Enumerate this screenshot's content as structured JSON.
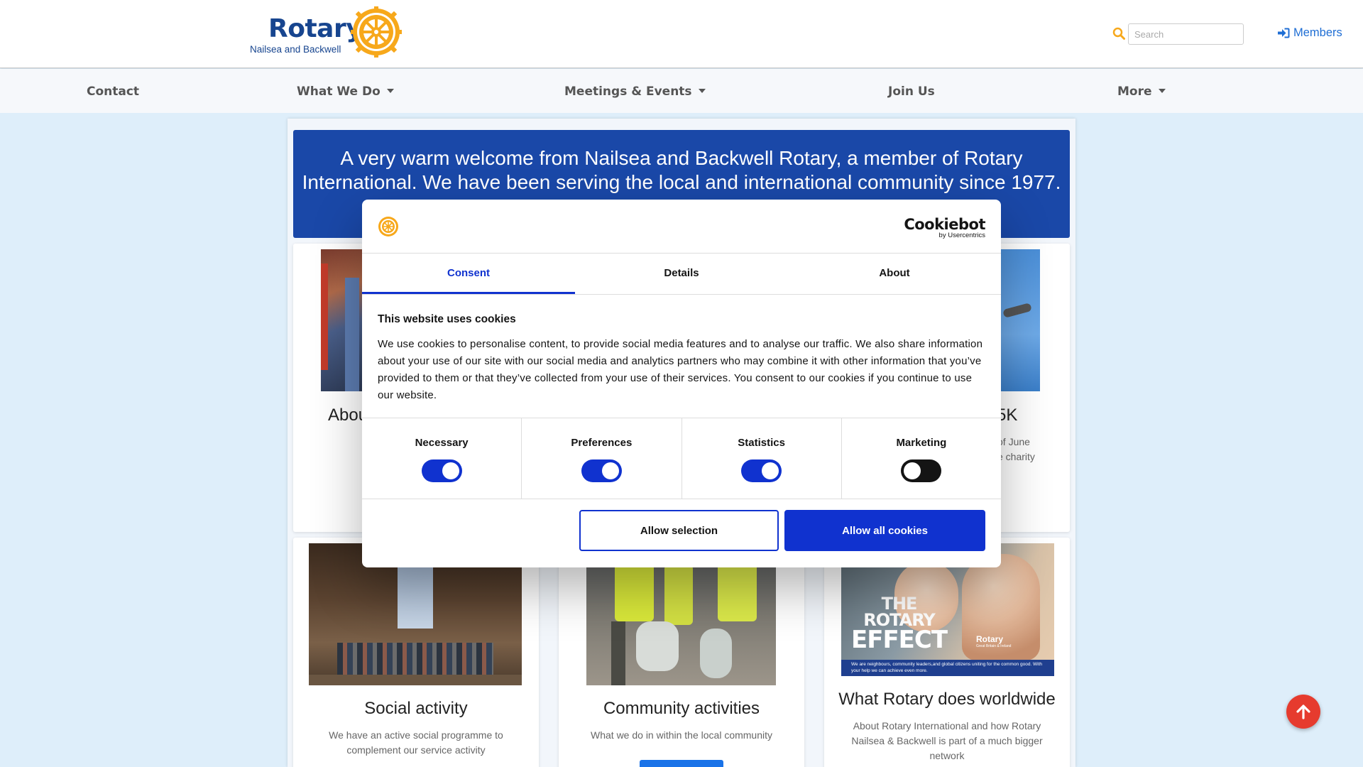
{
  "header": {
    "logo_text": "Rotary",
    "logo_subtitle": "Nailsea and Backwell",
    "search_placeholder": "Search",
    "members_label": "Members",
    "accent": "#17458f",
    "gold": "#f7a81b"
  },
  "nav": {
    "items": [
      {
        "label": "Contact"
      },
      {
        "label": "What We Do"
      },
      {
        "label": "Meetings & Events"
      },
      {
        "label": "Join Us"
      },
      {
        "label": "More"
      }
    ]
  },
  "banner": {
    "text": "A very warm welcome from Nailsea and Backwell Rotary, a member of Rotary International. We have been serving the local and international community since 1977."
  },
  "cards_row1": [
    {
      "title_partial": "Abou"
    },
    {
      "title_partial": "5K",
      "text_partial_1": "of June",
      "text_partial_2": "e charity"
    }
  ],
  "cards_row2": [
    {
      "title": "Social activity",
      "text": "We have an active social programme to complement our service activity"
    },
    {
      "title": "Community activities",
      "text": "What we do in within the local community"
    },
    {
      "title": "What Rotary does worldwide",
      "text": "About Rotary International and how Rotary Nailsea & Backwell is part of a much bigger network",
      "poster": {
        "line1": "THE",
        "line2": "ROTARY",
        "line3": "EFFECT",
        "brand": "Rotary",
        "brand_sub": "Great Britain & Ireland",
        "tagline": "We are neighbours, community leaders,and global citizens uniting for the common good. With your help we can achieve even more."
      }
    }
  ],
  "cookie_dialog": {
    "brand_main": "Cookiebot",
    "brand_sub": "by Usercentrics",
    "tabs": [
      "Consent",
      "Details",
      "About"
    ],
    "active_tab": "Consent",
    "heading": "This website uses cookies",
    "body": "We use cookies to personalise content, to provide social media features and to analyse our traffic. We also share information about your use of our site with our social media and analytics partners who may combine it with other information that you’ve provided to them or that they’ve collected from your use of their services. You consent to our cookies if you continue to use our website.",
    "toggles": [
      {
        "label": "Necessary",
        "on": true
      },
      {
        "label": "Preferences",
        "on": true
      },
      {
        "label": "Statistics",
        "on": true
      },
      {
        "label": "Marketing",
        "on": false
      }
    ],
    "allow_selection_label": "Allow selection",
    "allow_all_label": "Allow all cookies",
    "accent": "#1032cf"
  },
  "scroll_top_icon": "arrow-up-icon"
}
